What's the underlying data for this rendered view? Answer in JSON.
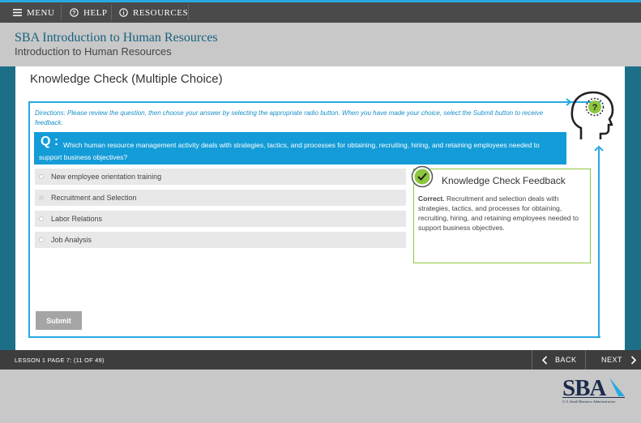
{
  "topbar": {
    "menu_label": "MENU",
    "help_label": "HELP",
    "resources_label": "RESOURCES"
  },
  "course": {
    "title": "SBA Introduction to Human Resources",
    "subtitle": "Introduction to Human Resources"
  },
  "page": {
    "heading": "Knowledge Check (Multiple Choice)",
    "directions": "Directions: Please review the question, then choose your answer by selecting the appropriate radio button. When you have made your choice, select the Submit button to receive feedback.",
    "question_label": "Q :",
    "question_text": "Which human resource management activity deals with strategies, tactics, and processes for obtaining, recruiting, hiring, and retaining employees needed to support business objectives?",
    "options": [
      {
        "label": "New employee orientation training",
        "selected": false
      },
      {
        "label": "Recruitment and Selection",
        "selected": true
      },
      {
        "label": "Labor Relations",
        "selected": false
      },
      {
        "label": "Job Analysis",
        "selected": false
      }
    ],
    "submit_label": "Submit"
  },
  "feedback": {
    "title": "Knowledge Check Feedback",
    "verdict": "Correct.",
    "text": " Recruitment and selection deals with strategies, tactics, and processes for obtaining, recruiting, hiring, and retaining employees needed to support business objectives."
  },
  "footer": {
    "lesson_label": "LESSON 1 PAGE 7: (11 OF 49)",
    "back_label": "BACK",
    "next_label": "NEXT"
  },
  "logo": {
    "text": "SBA",
    "tagline": "U.S. Small Business Administration"
  },
  "colors": {
    "accent": "#27a9e1",
    "question_bg": "#139cd8",
    "teal": "#1d6e87",
    "correct_green": "#8dc63f"
  }
}
